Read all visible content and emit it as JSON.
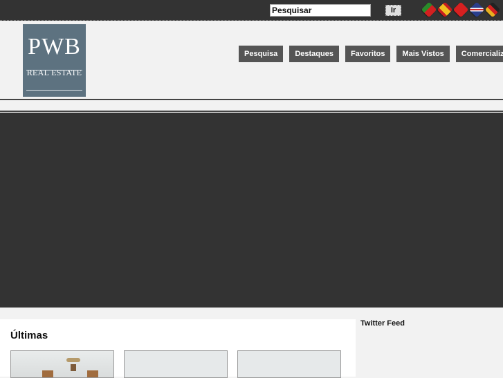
{
  "topbar": {
    "search_value": "Pesquisar",
    "go_label": "Ir",
    "flags": [
      {
        "name": "flag-portugal-icon",
        "colors": [
          "#2a8a2a",
          "#d22020"
        ]
      },
      {
        "name": "flag-spain-icon",
        "colors": [
          "#c61e1e",
          "#f0c020"
        ]
      },
      {
        "name": "flag-china-icon",
        "colors": [
          "#d82020",
          "#e02020"
        ]
      },
      {
        "name": "flag-uk-icon",
        "colors": [
          "#2a3e8c",
          "#d02828"
        ]
      },
      {
        "name": "flag-germany-icon",
        "colors": [
          "#222222",
          "#e8b020"
        ]
      }
    ]
  },
  "header": {
    "logo_main": "PWB",
    "logo_sub": "REAL ESTATE",
    "nav": [
      "Pesquisa",
      "Destaques",
      "Favoritos",
      "Mais Vistos",
      "Comercializar"
    ]
  },
  "main": {
    "section_title": "Últimas"
  },
  "sidebar": {
    "title": "Twitter Feed"
  },
  "colors": {
    "topbar": "#333333",
    "banner": "#333333",
    "logo_bg": "#5d7280",
    "nav_bg": "#555555"
  }
}
